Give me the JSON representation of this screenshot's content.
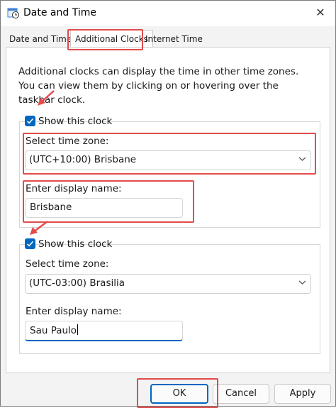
{
  "window": {
    "title": "Date and Time",
    "close_glyph": "✕"
  },
  "tabs": [
    {
      "label": "Date and Time"
    },
    {
      "label": "Additional Clocks"
    },
    {
      "label": "Internet Time"
    }
  ],
  "description": "Additional clocks can display the time in other time zones. You can view them by clicking on or hovering over the taskbar clock.",
  "clock1": {
    "show_label": "Show this clock",
    "checked": true,
    "timezone_label": "Select time zone:",
    "timezone_value": "(UTC+10:00) Brisbane",
    "name_label": "Enter display name:",
    "name_value": "Brisbane"
  },
  "clock2": {
    "show_label": "Show this clock",
    "checked": true,
    "timezone_label": "Select time zone:",
    "timezone_value": "(UTC-03:00) Brasilia",
    "name_label": "Enter display name:",
    "name_value": "Sau Paulo"
  },
  "buttons": {
    "ok": "OK",
    "cancel": "Cancel",
    "apply": "Apply"
  },
  "colors": {
    "accent": "#0067c0",
    "annotation": "#e34b4b"
  },
  "icons": {
    "app": "calendar-clock-icon",
    "dropdown": "chevron-down-icon",
    "check": "check-icon"
  }
}
